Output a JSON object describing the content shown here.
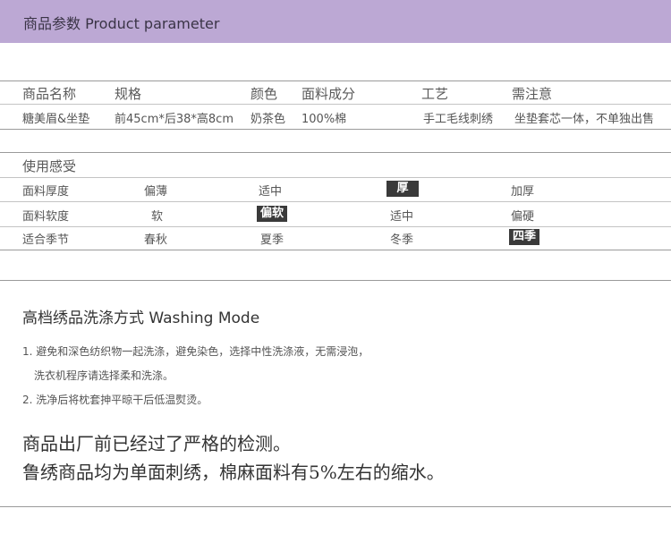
{
  "header": {
    "title": "商品参数 Product parameter"
  },
  "params": {
    "headers": [
      "商品名称",
      "规格",
      "颜色",
      "面料成分",
      "工艺",
      "需注意"
    ],
    "values": [
      "糖美眉&坐垫",
      "前45cm*后38*高8cm",
      "奶茶色",
      "100%棉",
      "手工毛线刺绣",
      "坐垫套芯一体，不单独出售"
    ]
  },
  "feel": {
    "title": "使用感受",
    "rows": [
      {
        "label": "面料厚度",
        "options": [
          "偏薄",
          "适中",
          "厚",
          "加厚"
        ],
        "selected": 2
      },
      {
        "label": "面料软度",
        "options": [
          "软",
          "偏软",
          "适中",
          "偏硬"
        ],
        "selected": 1
      },
      {
        "label": "适合季节",
        "options": [
          "春秋",
          "夏季",
          "冬季",
          "四季"
        ],
        "selected": 3
      }
    ]
  },
  "washing": {
    "title": "高档绣品洗涤方式 Washing Mode",
    "notes": [
      "1. 避免和深色纺织物一起洗涤，避免染色，选择中性洗涤液，无需浸泡，",
      "洗衣机程序请选择柔和洗涤。",
      "2. 洗净后将枕套抻平晾干后低温熨烫。"
    ],
    "statements": [
      "商品出厂前已经过了严格的检测。",
      "鲁绣商品均为单面刺绣，棉麻面料有5%左右的缩水。"
    ]
  }
}
